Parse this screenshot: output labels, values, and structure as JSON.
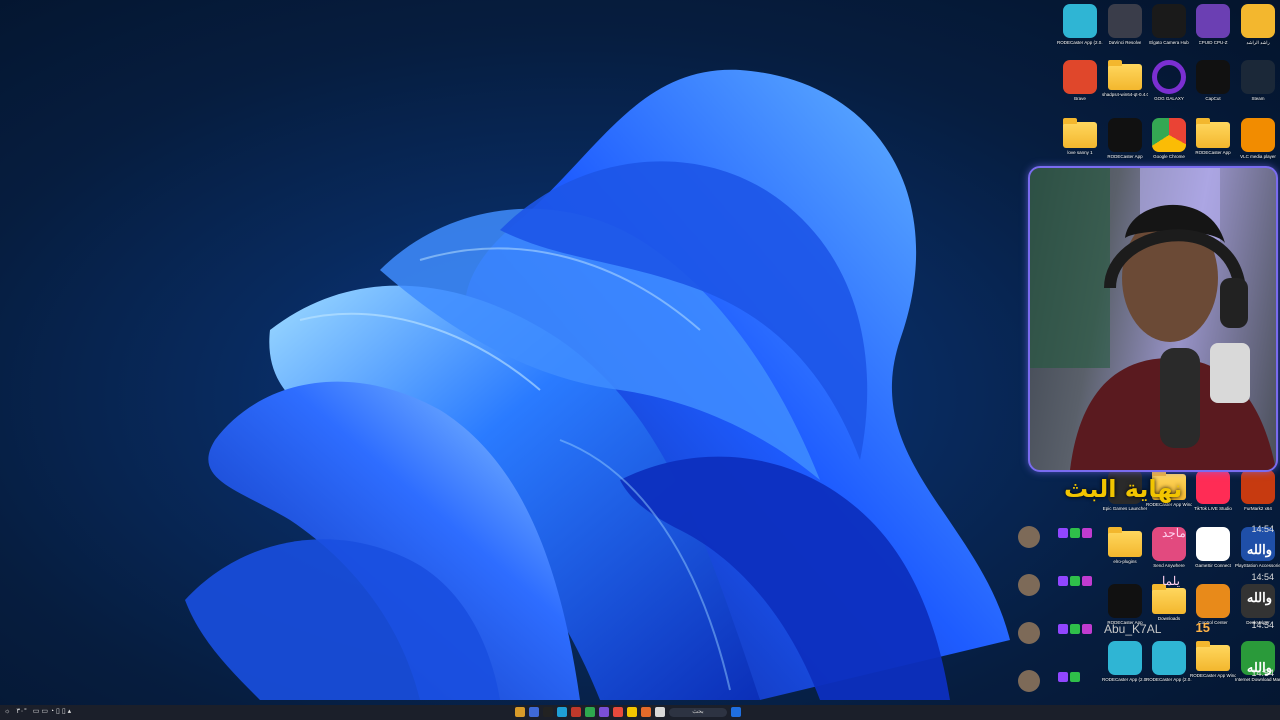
{
  "desktop_icons": {
    "row1": [
      {
        "label": "RODECaster App (2.0.175) - Wave",
        "icon": "rodecaster-app-icon",
        "color": "#2fb5d4"
      },
      {
        "label": "DaVinci Resolve",
        "icon": "davinci-resolve-icon",
        "color": "#3a3d4a"
      },
      {
        "label": "Elgato Camera Hub",
        "icon": "camera-hub-icon",
        "color": "#1a1a1a"
      },
      {
        "label": "CPUID CPU-Z",
        "icon": "cpu-z-icon",
        "color": "#6b3fb3"
      },
      {
        "label": "راشد الراشد",
        "icon": "user-folder-icon",
        "color": "#f3b72e"
      }
    ],
    "row2": [
      {
        "label": "Brave",
        "icon": "brave-icon",
        "color": "#e0472b"
      },
      {
        "label": "shadps4-win64-qt-0.4.0",
        "icon": "folder-icon",
        "color": "#f3b72e"
      },
      {
        "label": "GOG GALAXY",
        "icon": "gog-galaxy-icon",
        "color": "#7b2fd1"
      },
      {
        "label": "CapCut",
        "icon": "capcut-icon",
        "color": "#111111"
      },
      {
        "label": "Steam",
        "icon": "steam-icon",
        "color": "#1b2838"
      }
    ],
    "row3": [
      {
        "label": "love sanny 1",
        "icon": "folder-icon",
        "color": "#f3b72e"
      },
      {
        "label": "RODECaster App",
        "icon": "rodecaster-icon",
        "color": "#111111"
      },
      {
        "label": "Google Chrome",
        "icon": "chrome-icon",
        "color": "#ffffff"
      },
      {
        "label": "RODECaster App",
        "icon": "folder-icon",
        "color": "#f3b72e"
      },
      {
        "label": "VLC media player",
        "icon": "vlc-icon",
        "color": "#f28c00"
      }
    ],
    "row4": [
      {
        "label": "Epic Games Launcher",
        "icon": "epic-games-icon",
        "color": "#2a2a2a"
      },
      {
        "label": "RODECaster App Windows v2.0.1...",
        "icon": "folder-icon",
        "color": "#f3b72e"
      },
      {
        "label": "TikTok LIVE Studio",
        "icon": "tiktok-live-icon",
        "color": "#ff2c55"
      },
      {
        "label": "FurMark2 x64",
        "icon": "furmark-icon",
        "color": "#c73a10"
      }
    ],
    "row5": [
      {
        "label": "elro-plugins",
        "icon": "folder-icon",
        "color": "#f3b72e"
      },
      {
        "label": "Send Anywhere",
        "icon": "send-anywhere-icon",
        "color": "#e24a7f"
      },
      {
        "label": "GameSir Connect",
        "icon": "gamesir-icon",
        "color": "#ffffff"
      },
      {
        "label": "PlayStation Accessories",
        "icon": "playstation-icon",
        "color": "#1f4fa8"
      }
    ],
    "row6": [
      {
        "label": "RODECaster App",
        "icon": "rodecaster-icon",
        "color": "#111111"
      },
      {
        "label": "Downloads",
        "icon": "folder-icon",
        "color": "#f3b72e"
      },
      {
        "label": "Control Center",
        "icon": "control-center-icon",
        "color": "#e88a1a"
      },
      {
        "label": "DeskHelper",
        "icon": "deskhelper-icon",
        "color": "#333333"
      }
    ],
    "row7": [
      {
        "label": "RODECaster App (2.0.190)",
        "icon": "rodecaster-app-icon",
        "color": "#2fb5d4"
      },
      {
        "label": "RODECaster App (2.0.175)",
        "icon": "rodecaster-app-icon",
        "color": "#2fb5d4"
      },
      {
        "label": "RODECaster App Windows v2.0.11",
        "icon": "folder-icon",
        "color": "#f3b72e"
      },
      {
        "label": "Internet Download Manager",
        "icon": "idm-icon",
        "color": "#2a9a3a"
      }
    ]
  },
  "overlay": {
    "alert_title": "نهاية البث"
  },
  "chat": [
    {
      "name": "ماجد",
      "message": "والله",
      "time": "14:54"
    },
    {
      "name": "يلما",
      "message": "والله",
      "time": "14:54"
    },
    {
      "name": "Abu_K7AL",
      "message": "15",
      "time": "14:54"
    },
    {
      "name": "",
      "message": "والله",
      "time": "14:54"
    }
  ],
  "taskbar": {
    "weather": "٣٠°",
    "search_placeholder": "بحث"
  },
  "colors": {
    "accent": "#7a6cf0",
    "alert": "#f2c500"
  }
}
